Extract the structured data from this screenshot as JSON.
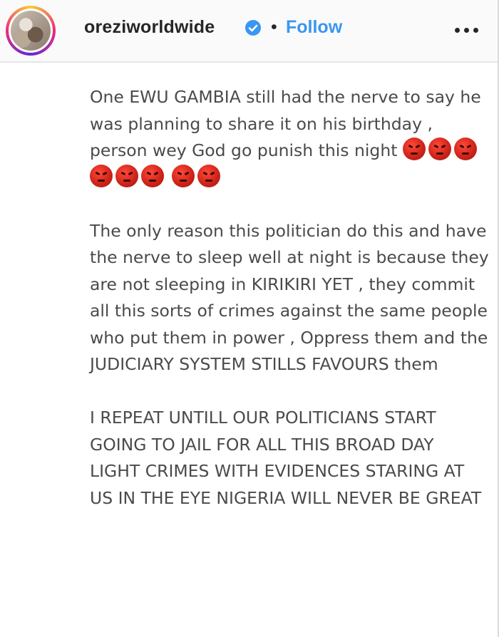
{
  "post": {
    "username": "oreziworldwide",
    "separator": "•",
    "follow_label": "Follow",
    "verified_icon": "verified-badge-icon",
    "more_icon": "more-options-icon",
    "accent_color": "#3897f0"
  },
  "caption": {
    "paragraph1": "One EWU GAMBIA still had the nerve to say he was planning to share it on his birthday , person wey God go punish this night",
    "paragraph1_emoji": "angry-face-icon",
    "paragraph1_emoji_count": 8,
    "paragraph2": "The only reason this politician do this and have the nerve to sleep well at night is because they are not sleeping in KIRIKIRI YET , they commit all this sorts of crimes against the same people who put them in power , Oppress them and the JUDICIARY SYSTEM STILLS FAVOURS them",
    "paragraph3": "I REPEAT UNTILL OUR POLITICIANS START GOING TO JAIL FOR ALL THIS BROAD DAY LIGHT CRIMES WITH EVIDENCES STARING AT US IN THE EYE NIGERIA WILL NEVER BE GREAT"
  }
}
